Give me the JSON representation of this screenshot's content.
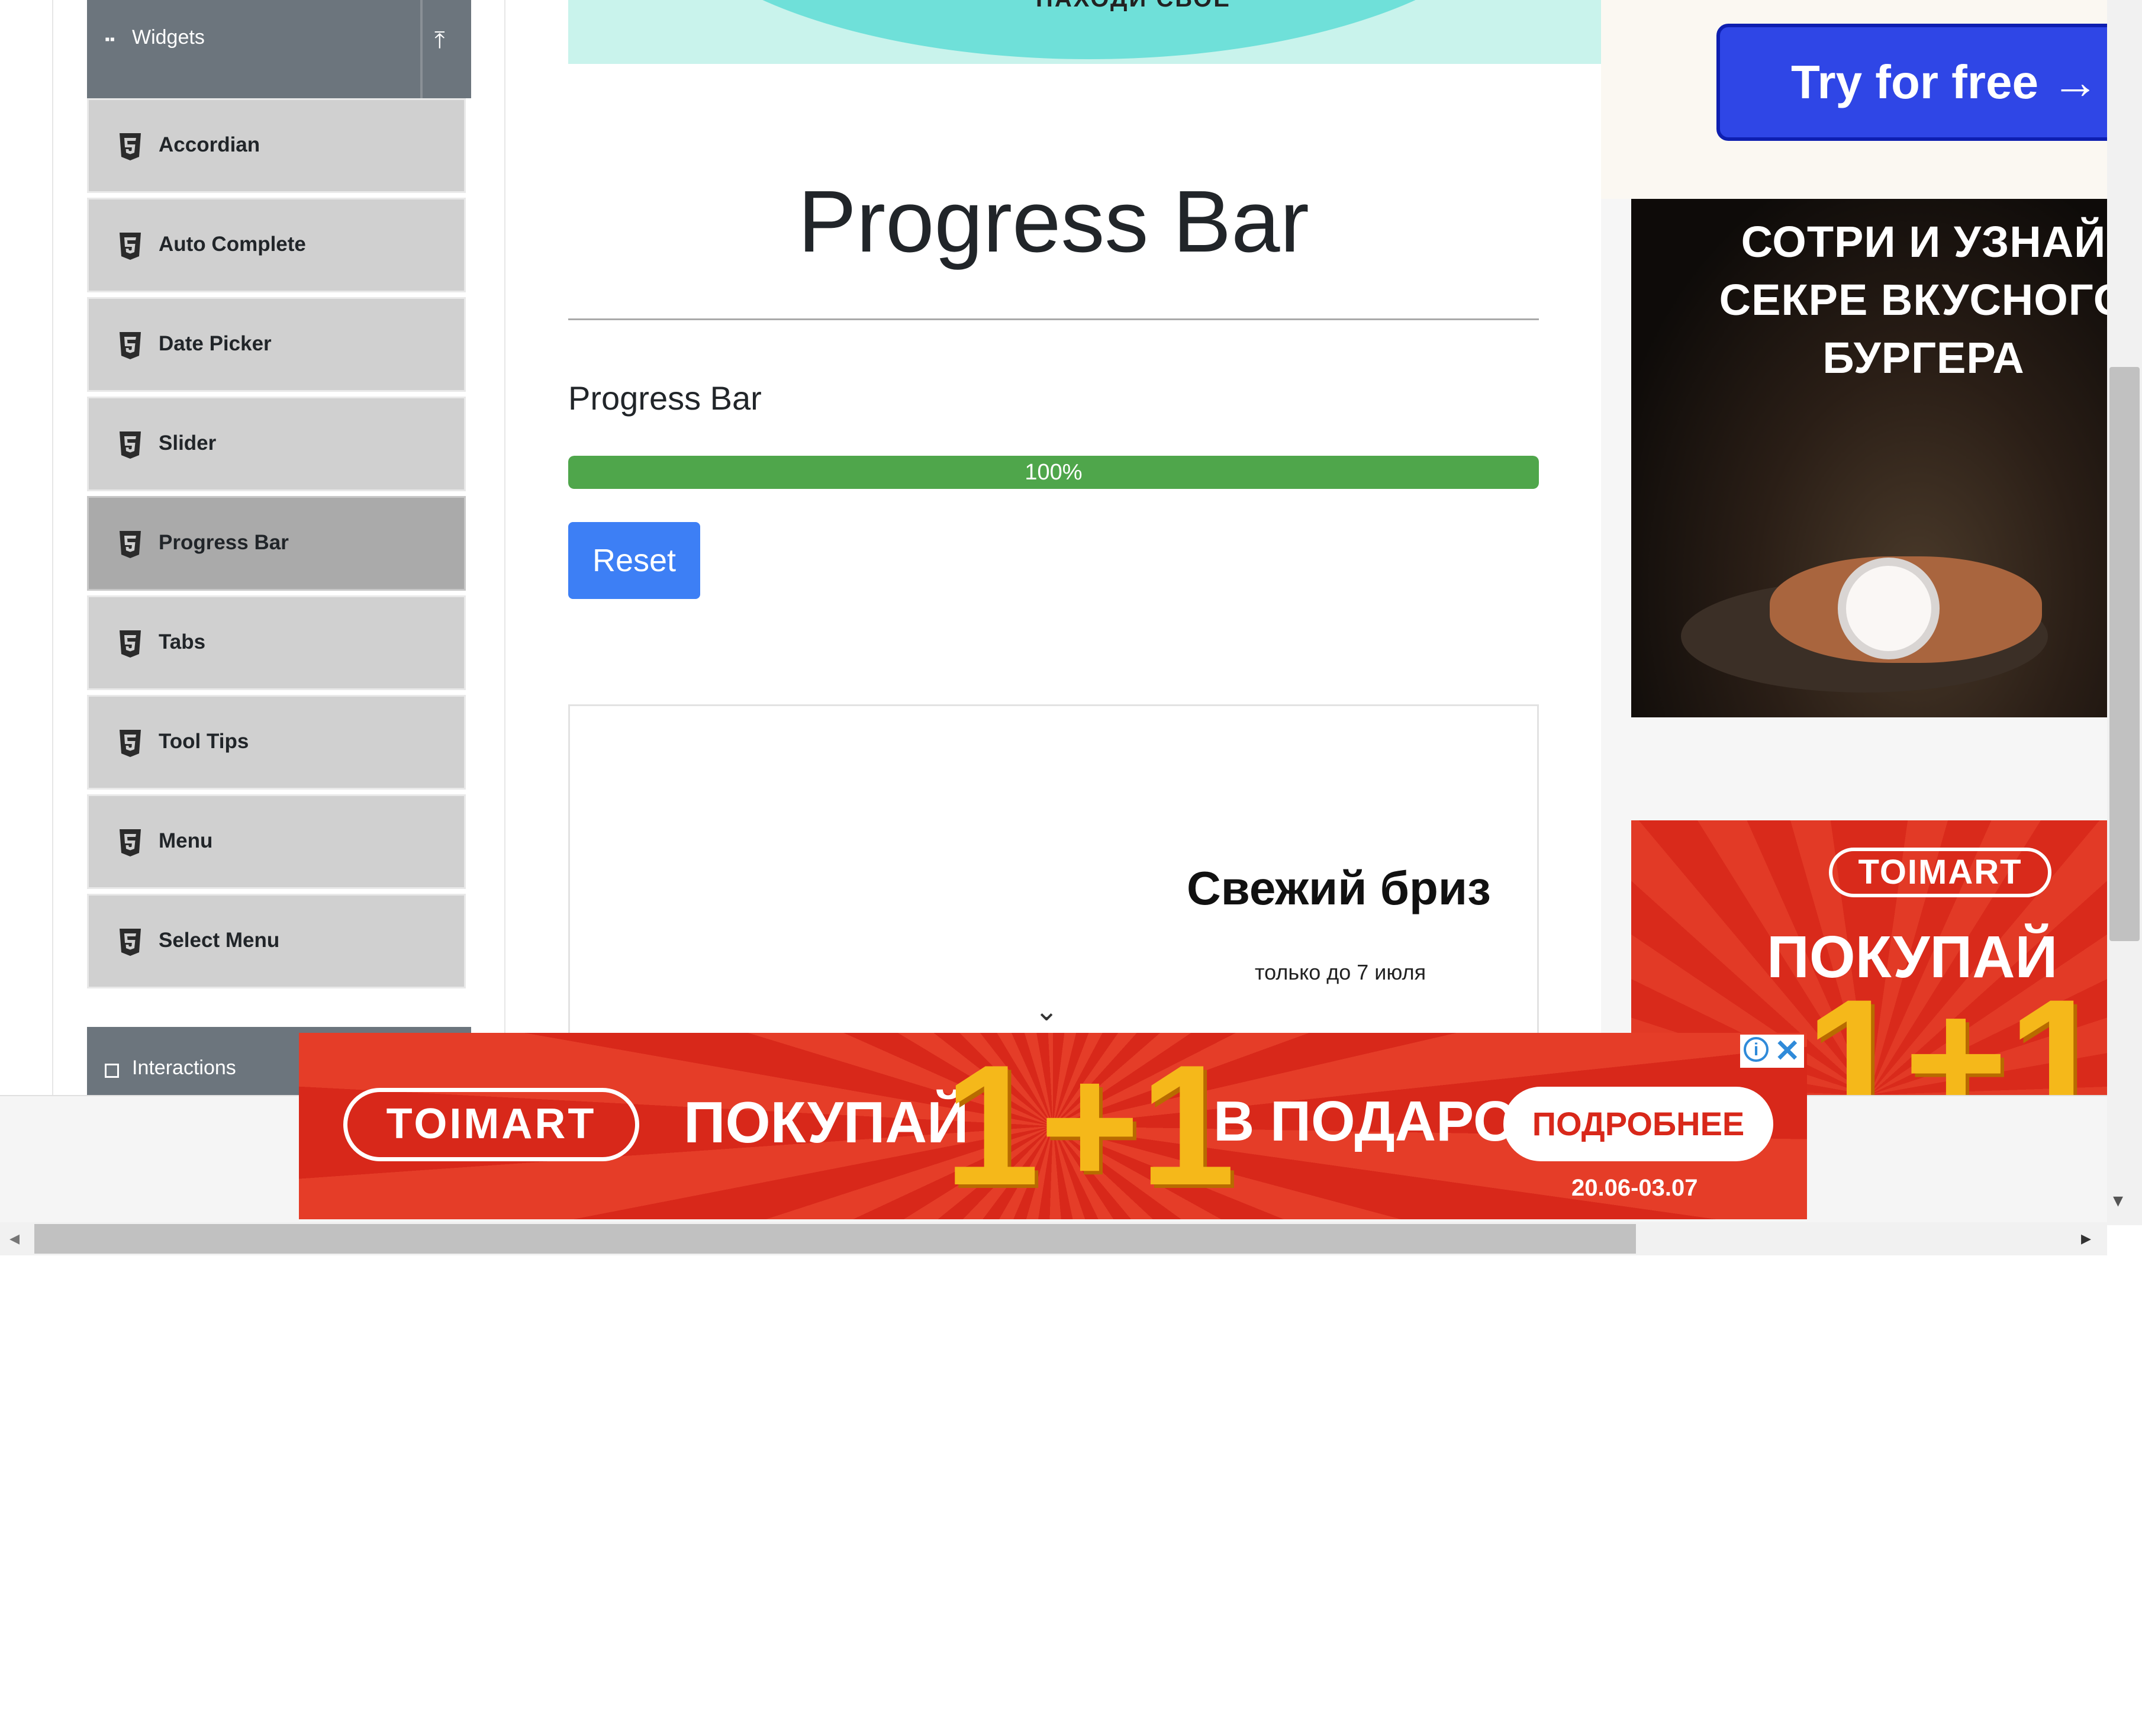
{
  "sidebar": {
    "widgets_group": {
      "label": "Widgets",
      "icon": "widgets-icon"
    },
    "items": [
      {
        "label": "Accordian",
        "icon": "html5-icon"
      },
      {
        "label": "Auto Complete",
        "icon": "html5-icon"
      },
      {
        "label": "Date Picker",
        "icon": "html5-icon"
      },
      {
        "label": "Slider",
        "icon": "html5-icon"
      },
      {
        "label": "Progress Bar",
        "icon": "html5-icon",
        "active": true
      },
      {
        "label": "Tabs",
        "icon": "html5-icon"
      },
      {
        "label": "Tool Tips",
        "icon": "html5-icon"
      },
      {
        "label": "Menu",
        "icon": "html5-icon"
      },
      {
        "label": "Select Menu",
        "icon": "html5-icon"
      }
    ],
    "interactions_group": {
      "label": "Interactions",
      "icon": "interactions-icon"
    }
  },
  "main": {
    "hero_text": "НАХОДИ СВОЁ",
    "page_title": "Progress Bar",
    "section_label": "Progress Bar",
    "progress": {
      "value": 100,
      "label": "100%"
    },
    "reset_label": "Reset",
    "ad": {
      "title": "Свежий бриз",
      "subtitle": "только до 7 июля"
    }
  },
  "right_ads": {
    "try_label": "Try for free →",
    "burger_text": "СОТРИ И УЗНАЙ СЕКРЕ ВКУСНОГО БУРГЕРА",
    "toimart_logo": "TOIMART",
    "toimart_buy": "ПОКУПАЙ",
    "toimart_big": "1+1"
  },
  "bottom_ad": {
    "logo": "TOIMART",
    "buy": "ПОКУПАЙ",
    "big": "1+1",
    "gift": "В ПОДАРОК",
    "more": "ПОДРОБНЕЕ",
    "date": "20.06-03.07"
  },
  "colors": {
    "accent": "#3d7ff5",
    "progress_fill": "#4fa64b",
    "sidebar_header": "#6c757d"
  }
}
